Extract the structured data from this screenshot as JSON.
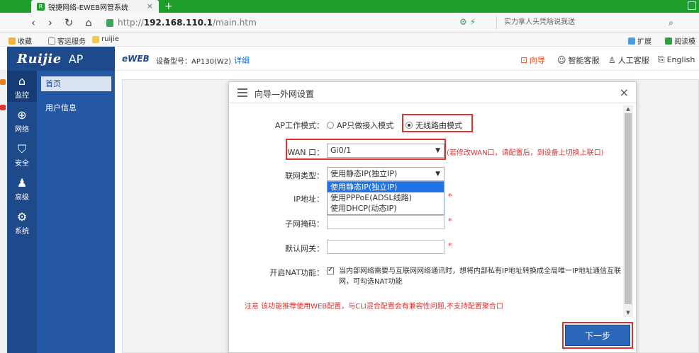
{
  "browser": {
    "tab_title": "锐捷网络-EWEB网管系统",
    "tab_close": "×",
    "new_tab": "+",
    "url_proto": "http://",
    "url_host": "192.168.110.1",
    "url_path": "/main.htm",
    "search_placeholder": "实力拿人头凭啥说我送",
    "bookmarks": [
      "收藏",
      "客运服务",
      "ruijie"
    ],
    "bm_right": [
      "扩展",
      "阅读模"
    ]
  },
  "app": {
    "brand": "Ruijie",
    "product": "AP",
    "eweb": "eWEB",
    "device_label": "设备型号：AP130(W2)",
    "detail_link": "详细",
    "header_links": [
      {
        "icon": "guide-icon",
        "label": "向导"
      },
      {
        "icon": "smart-service-icon",
        "label": "智能客服"
      },
      {
        "icon": "person-icon",
        "label": "人工客服"
      },
      {
        "icon": "language-icon",
        "label": "English"
      }
    ]
  },
  "sidebar": {
    "items": [
      {
        "label": "监控",
        "icon": "home-icon",
        "symbol": "⌂"
      },
      {
        "label": "网络",
        "icon": "globe-icon",
        "symbol": "⊕"
      },
      {
        "label": "安全",
        "icon": "shield-icon",
        "symbol": "⛉"
      },
      {
        "label": "高级",
        "icon": "users-icon",
        "symbol": "♟"
      },
      {
        "label": "系统",
        "icon": "gear-icon",
        "symbol": "⚙"
      }
    ]
  },
  "subnav": {
    "items": [
      "首页",
      "用户信息"
    ]
  },
  "modal": {
    "title": "向导—外网设置",
    "close": "×",
    "ap_mode_label": "AP工作模式：",
    "ap_mode_options": [
      "AP只做接入模式",
      "无线路由模式"
    ],
    "wan_label": "WAN 口：",
    "wan_value": "Gi0/1",
    "wan_hint": "(若修改WAN口，请配置后，到设备上切换上联口)",
    "conn_type_label": "联网类型：",
    "conn_type_value": "使用静态IP(独立IP)",
    "conn_type_options": [
      "使用静态IP(独立IP)",
      "使用PPPoE(ADSL线路)",
      "使用DHCP(动态IP)"
    ],
    "ip_label": "IP地址：",
    "mask_label": "子网掩码：",
    "gateway_label": "默认网关：",
    "required_mark": "*",
    "nat_label": "开启NAT功能：",
    "nat_text": "当内部网络需要与互联网网络通讯时，想将内部私有IP地址转换成全局唯一IP地址通信互联网，可勾选NAT功能",
    "notice": "注意 该功能推荐使用WEB配置，与CLI混合配置会有兼容性问题,不支持配置聚合口",
    "next_button": "下一步"
  }
}
